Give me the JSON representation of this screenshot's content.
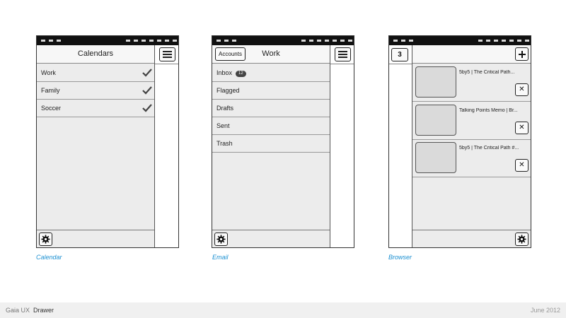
{
  "calendar": {
    "header_title": "Calendars",
    "items": [
      {
        "label": "Work",
        "checked": true
      },
      {
        "label": "Family",
        "checked": true
      },
      {
        "label": "Soccer",
        "checked": true
      }
    ],
    "caption": "Calendar"
  },
  "email": {
    "accounts_label": "Accounts",
    "header_title": "Work",
    "items": [
      {
        "label": "Inbox",
        "badge": "12"
      },
      {
        "label": "Flagged"
      },
      {
        "label": "Drafts"
      },
      {
        "label": "Sent"
      },
      {
        "label": "Trash"
      }
    ],
    "caption": "Email"
  },
  "browser": {
    "tab_count": "3",
    "tabs": [
      {
        "title": "5by5 | The Critical Path..."
      },
      {
        "title": "Talking Points Memo | Br..."
      },
      {
        "title": "5by5 | The Critical Path #..."
      }
    ],
    "caption": "Browser"
  },
  "footer": {
    "brand": "Gaia UX",
    "subtitle": "Drawer",
    "date": "June 2012"
  },
  "icons": {
    "menu": "hamburger-menu-icon",
    "settings": "gear-icon",
    "check": "checkmark-icon",
    "add": "plus-icon",
    "close": "close-icon"
  },
  "colors": {
    "caption": "#1a8fd1",
    "status_bar": "#111111",
    "panel": "#ececec"
  }
}
